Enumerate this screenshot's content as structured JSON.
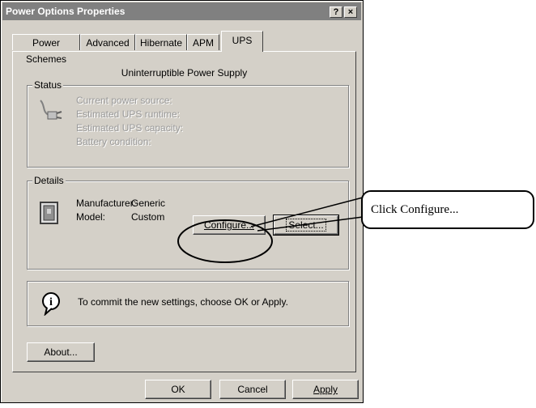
{
  "window": {
    "title": "Power Options Properties",
    "help_btn": "?",
    "close_btn": "×"
  },
  "tabs": [
    {
      "label": "Power Schemes"
    },
    {
      "label": "Advanced"
    },
    {
      "label": "Hibernate"
    },
    {
      "label": "APM"
    },
    {
      "label": "UPS"
    }
  ],
  "ups": {
    "heading": "Uninterruptible Power Supply",
    "status": {
      "title": "Status",
      "lines": [
        "Current power source:",
        "Estimated UPS runtime:",
        "Estimated UPS capacity:",
        "Battery condition:"
      ]
    },
    "details": {
      "title": "Details",
      "manufacturer_label": "Manufacturer:",
      "manufacturer_value": "Generic",
      "model_label": "Model:",
      "model_value": "Custom",
      "configure_label": "Configure...",
      "select_label": "Select..."
    },
    "info_text": "To commit the new settings, choose OK or Apply.",
    "about_label": "About..."
  },
  "footer": {
    "ok": "OK",
    "cancel": "Cancel",
    "apply": "Apply"
  },
  "annotation": {
    "text": "Click Configure..."
  },
  "icons": {
    "plug": "power-plug-icon",
    "ups": "ups-device-icon",
    "info": "info-icon"
  }
}
